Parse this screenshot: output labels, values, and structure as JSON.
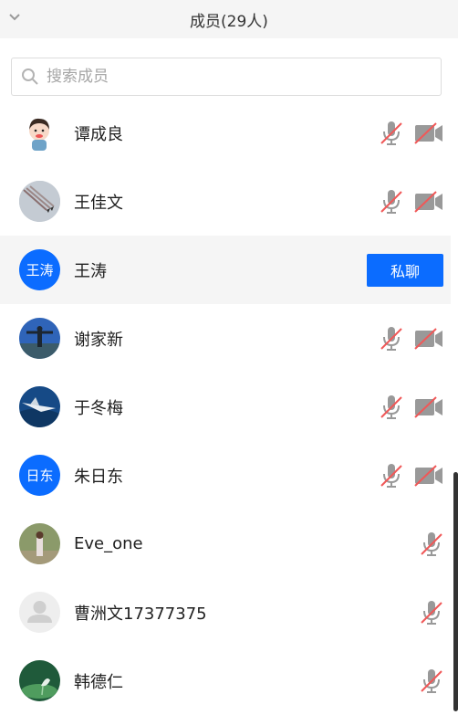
{
  "header": {
    "title": "成员(29人)"
  },
  "search": {
    "placeholder": "搜索成员"
  },
  "members": [
    {
      "name": "谭成良",
      "avatar": "photo-child",
      "mic": true,
      "video": true
    },
    {
      "name": "王佳文",
      "avatar": "photo-airshow",
      "mic": true,
      "video": true
    },
    {
      "name": "王涛",
      "avatar_text": "王涛",
      "highlighted": true,
      "action": "私聊"
    },
    {
      "name": "谢家新",
      "avatar": "photo-person-sky",
      "mic": true,
      "video": true
    },
    {
      "name": "于冬梅",
      "avatar": "photo-airplane",
      "mic": true,
      "video": true
    },
    {
      "name": "朱日东",
      "avatar_text": "日东",
      "mic": true,
      "video": true
    },
    {
      "name": "Eve_one",
      "avatar": "photo-outdoor-person",
      "mic": true,
      "video": false
    },
    {
      "name": "曹洲文17377375",
      "avatar": "default-avatar",
      "mic": true,
      "video": false
    },
    {
      "name": "韩德仁",
      "avatar": "photo-green",
      "mic": true,
      "video": false
    }
  ],
  "colors": {
    "accent": "#0b6cff",
    "muted_red": "#f05858",
    "icon_gray": "#999999"
  }
}
